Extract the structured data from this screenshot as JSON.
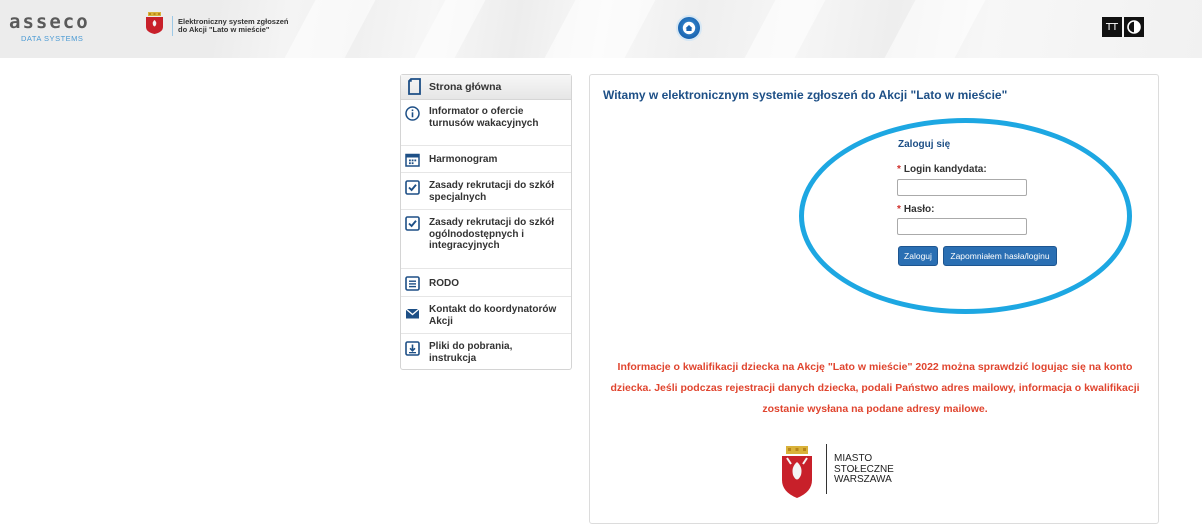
{
  "header": {
    "logo": {
      "name": "asseco",
      "tagline": "DATA SYSTEMS"
    },
    "title_lines": [
      "Elektroniczny system zgłoszeń",
      "do Akcji \"Lato w mieście\""
    ],
    "home_icon": "home-icon",
    "font_size_label": "TT",
    "contrast_icon": "contrast-icon"
  },
  "menu": {
    "title": "Strona główna",
    "title_icon": "document-icon",
    "items": [
      {
        "label": "Informator o ofercie turnusów wakacyjnych",
        "icon": "info-icon"
      },
      {
        "label": "Harmonogram",
        "icon": "calendar-icon"
      },
      {
        "label": "Zasady rekrutacji do szkół specjalnych",
        "icon": "checkbox-icon"
      },
      {
        "label": "Zasady rekrutacji do szkół ogólnodostępnych i integracyjnych",
        "icon": "checkbox-icon"
      },
      {
        "label": "RODO",
        "icon": "list-icon"
      },
      {
        "label": "Kontakt do koordynatorów Akcji",
        "icon": "mail-icon"
      },
      {
        "label": "Pliki do pobrania, instrukcja",
        "icon": "download-icon"
      }
    ]
  },
  "main": {
    "welcome": "Witamy w elektronicznym systemie zgłoszeń do Akcji \"Lato w mieście\"",
    "login": {
      "title": "Zaloguj się",
      "required_mark": "*",
      "login_label": "Login kandydata:",
      "login_value": "",
      "password_label": "Hasło:",
      "password_value": "",
      "submit_label": "Zaloguj",
      "forgot_label": "Zapomniałem hasła/loginu"
    },
    "info": "Informacje o kwalifikacji dziecka na Akcję \"Lato w mieście\" 2022 można sprawdzić logując się na konto dziecka. Jeśli podczas rejestracji danych dziecka, podali Państwo adres mailowy, informacja o kwalifikacji zostanie wysłana na podane adresy mailowe.",
    "city_lines": [
      "MIASTO",
      "STOŁECZNE",
      "WARSZAWA"
    ]
  },
  "colors": {
    "accent": "#2a6fb3",
    "title_blue": "#1d4f86",
    "highlight_ellipse": "#1da7e2",
    "info_red": "#e0452f"
  }
}
